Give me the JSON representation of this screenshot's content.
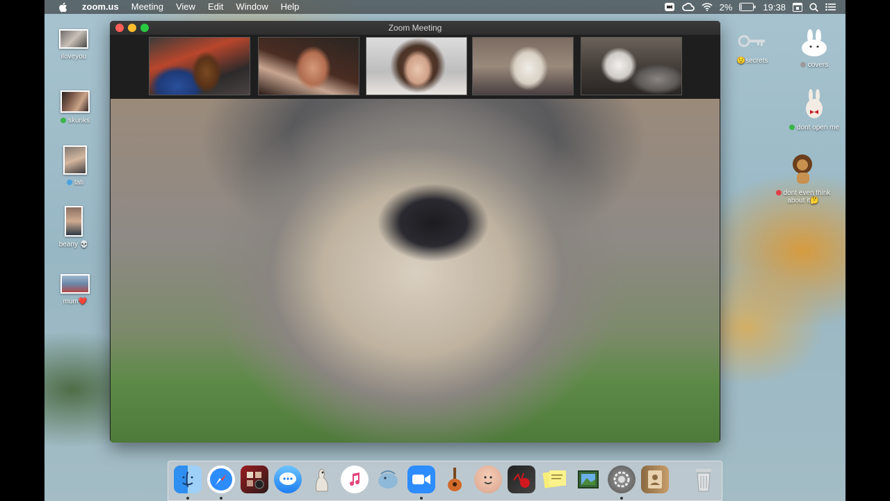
{
  "menubar": {
    "apple_icon": "apple-logo-icon",
    "items": [
      "zoom.us",
      "Meeting",
      "View",
      "Edit",
      "Window",
      "Help"
    ],
    "battery": "2%",
    "clock": "19:38"
  },
  "window": {
    "title": "Zoom Meeting",
    "close_color": "#ff5f57",
    "minimize_color": "#febc2e",
    "zoom_color": "#28c840"
  },
  "participants": [
    {
      "name": "dachshund-video"
    },
    {
      "name": "man-video"
    },
    {
      "name": "woman-video"
    },
    {
      "name": "terrier-video"
    },
    {
      "name": "husky-video"
    }
  ],
  "desktop_left": [
    {
      "label": "iloveyou",
      "tag": ""
    },
    {
      "label": "skunks",
      "tag": "#3bb54a"
    },
    {
      "label": "tati",
      "tag": "#4aa3df"
    },
    {
      "label": "beany 💀",
      "tag": ""
    },
    {
      "label": "mum❤️",
      "tag": ""
    }
  ],
  "desktop_right": [
    {
      "label": "secrets",
      "emoji": "😟"
    },
    {
      "label": "covers",
      "tag": "#9a9a9a"
    },
    {
      "label": "dont open me",
      "tag": "#3bb54a"
    },
    {
      "label": "dont even think about it",
      "tag": "#e0414a",
      "emoji": "🤔"
    }
  ],
  "dock": {
    "apps": [
      "finder",
      "safari",
      "photo-booth",
      "messages",
      "kangaroo",
      "itunes",
      "sequel-pro",
      "zoom",
      "garageband",
      "face-app",
      "scrobbles",
      "stickies",
      "preview",
      "system-preferences",
      "contacts",
      "trash"
    ]
  }
}
